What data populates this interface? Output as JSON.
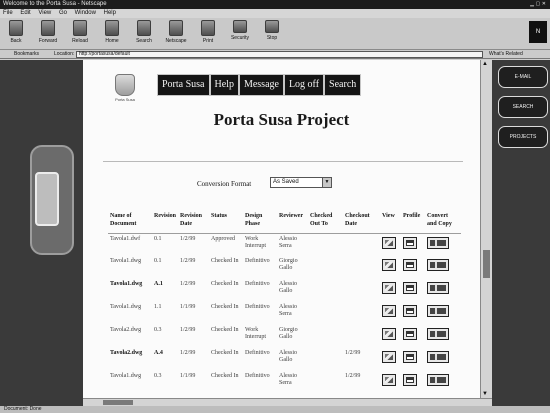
{
  "window": {
    "title": "Welcome to the Porta Susa - Netscape"
  },
  "menu": [
    "File",
    "Edit",
    "View",
    "Go",
    "Window",
    "Help"
  ],
  "toolbar": [
    {
      "label": "Back",
      "icon": "back-arrow-icon"
    },
    {
      "label": "Forward",
      "icon": "forward-arrow-icon"
    },
    {
      "label": "Reload",
      "icon": "reload-icon"
    },
    {
      "label": "Home",
      "icon": "home-icon"
    },
    {
      "label": "Search",
      "icon": "search-icon"
    },
    {
      "label": "Netscape",
      "icon": "netscape-icon"
    },
    {
      "label": "Print",
      "icon": "print-icon"
    },
    {
      "label": "Security",
      "icon": "lock-icon"
    },
    {
      "label": "Stop",
      "icon": "stop-icon"
    }
  ],
  "throbber": {
    "text": "N"
  },
  "location": {
    "bookmarks_label": "Bookmarks",
    "location_label": "Location:",
    "url": "http://portasusa/default",
    "related_label": "What's Related"
  },
  "side_tabs": [
    "E-MAIL",
    "SEARCH",
    "PROJECTS"
  ],
  "site": {
    "logo_text": "Porta Susa",
    "nav": [
      "Porta Susa",
      "Help",
      "Message",
      "Log off",
      "Search"
    ],
    "title": "Porta Susa Project",
    "conversion_label": "Conversion Format",
    "conversion_value": "As Saved"
  },
  "table": {
    "headers": [
      "Name of Document",
      "Revision",
      "Revision Date",
      "Status",
      "Design Phase",
      "Reviewer",
      "Checked Out To",
      "Checkout Date",
      "View",
      "Profile",
      "Convert and Copy"
    ],
    "rows": [
      {
        "name": "Tavola1.dwf",
        "revision": "0.1",
        "date": "1/2/99",
        "status": "Approved",
        "phase": "Work Interrupt",
        "reviewer": "Alessio Serra",
        "checked_out": "",
        "checkout_date": "",
        "bold": false
      },
      {
        "name": "Tavola1.dwg",
        "revision": "0.1",
        "date": "1/2/99",
        "status": "Checked In",
        "phase": "Definitivo",
        "reviewer": "Giorgio Gallo",
        "checked_out": "",
        "checkout_date": "",
        "bold": false
      },
      {
        "name": "Tavola1.dwg",
        "revision": "A.1",
        "date": "1/2/99",
        "status": "Checked In",
        "phase": "Definitivo",
        "reviewer": "Alessio Gallo",
        "checked_out": "",
        "checkout_date": "",
        "bold": true
      },
      {
        "name": "Tavola1.dwg",
        "revision": "1.1",
        "date": "1/1/99",
        "status": "Checked In",
        "phase": "Definitivo",
        "reviewer": "Alessio Serra",
        "checked_out": "",
        "checkout_date": "",
        "bold": false
      },
      {
        "name": "Tavola2.dwg",
        "revision": "0.3",
        "date": "1/2/99",
        "status": "Checked In",
        "phase": "Work Interrupt",
        "reviewer": "Giorgio Gallo",
        "checked_out": "",
        "checkout_date": "",
        "bold": false
      },
      {
        "name": "Tavola2.dwg",
        "revision": "A.4",
        "date": "1/2/99",
        "status": "Checked In",
        "phase": "Definitivo",
        "reviewer": "Alessio Gallo",
        "checked_out": "",
        "checkout_date": "1/2/99",
        "bold": true
      },
      {
        "name": "Tavola1.dwg",
        "revision": "0.3",
        "date": "1/1/99",
        "status": "Checked In",
        "phase": "Definitivo",
        "reviewer": "Alessio Serra",
        "checked_out": "",
        "checkout_date": "1/2/99",
        "bold": false
      }
    ]
  },
  "status_bar": {
    "text": "Document: Done"
  }
}
